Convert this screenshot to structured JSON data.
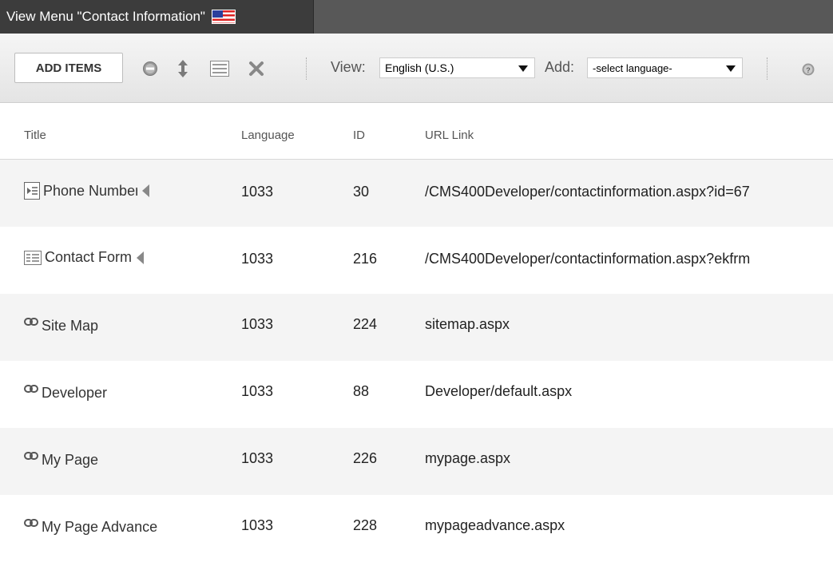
{
  "header": {
    "title": "View Menu \"Contact Information\"",
    "flag_icon": "us-flag-icon"
  },
  "toolbar": {
    "add_items_label": "ADD ITEMS",
    "icons": [
      "remove-icon",
      "reorder-icon",
      "properties-icon",
      "delete-icon",
      "help-icon"
    ],
    "view_label": "View:",
    "view_value": "English (U.S.)",
    "add_label": "Add:",
    "add_value": "-select language-"
  },
  "table": {
    "columns": {
      "title": "Title",
      "language": "Language",
      "id": "ID",
      "url": "URL Link"
    },
    "rows": [
      {
        "title": "Phone Numbers",
        "language": "1033",
        "id": "30",
        "url": "/CMS400Developer/contactinformation.aspx?id=67",
        "icon": "content-icon",
        "has_submenu": true
      },
      {
        "title": "Contact Form",
        "language": "1033",
        "id": "216",
        "url": "/CMS400Developer/contactinformation.aspx?ekfrm",
        "icon": "form-icon",
        "has_submenu": true
      },
      {
        "title": "Site Map",
        "language": "1033",
        "id": "224",
        "url": "sitemap.aspx",
        "icon": "link-icon",
        "has_submenu": false
      },
      {
        "title": "Developer",
        "language": "1033",
        "id": "88",
        "url": "Developer/default.aspx",
        "icon": "link-icon",
        "has_submenu": false
      },
      {
        "title": "My Page",
        "language": "1033",
        "id": "226",
        "url": "mypage.aspx",
        "icon": "link-icon",
        "has_submenu": false
      },
      {
        "title": "My Page Advance",
        "language": "1033",
        "id": "228",
        "url": "mypageadvance.aspx",
        "icon": "link-icon",
        "has_submenu": false
      }
    ]
  }
}
